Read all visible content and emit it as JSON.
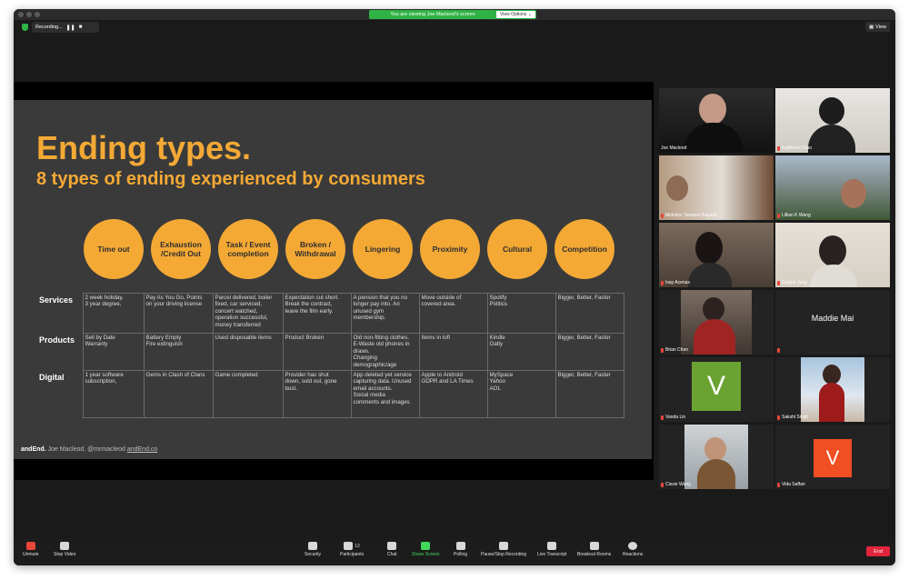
{
  "window": {
    "viewing_banner": "You are viewing Joe Macleod's screen",
    "view_options": "View Options ⌄",
    "recording": "Recording...",
    "view_button": "View"
  },
  "slide": {
    "title": "Ending types.",
    "subtitle": "8 types of ending experienced by consumers",
    "circles": [
      "Time out",
      "Exhaustion\n/Credit Out",
      "Task / Event\ncompletion",
      "Broken /\nWithdrawal",
      "Lingering",
      "Proximity",
      "Cultural",
      "Competition"
    ],
    "rows": [
      {
        "label": "Services",
        "cells": [
          "2 week holiday,\n3 year degree,",
          "Pay As You Go, Points\non your driving license",
          "Parcel delivered, boiler\nfixed, car serviced,\nconcert watched,\noperation successful,\nmoney transferred",
          "Expectation cut short.\nBreak the contract,\nleave the film early.",
          "A pension that you no\nlonger pay into. An\nunused gym\nmembership.",
          "Move outside of\ncovered area.",
          "Spotify\nPolitics",
          "Bigger, Better, Faster"
        ]
      },
      {
        "label": "Products",
        "cells": [
          "Sell by Date\nWarranty",
          "Battery Empty\nFire extinguish",
          "Used disposable items",
          "Product Broken",
          "Old non-fitting clothes.\nE-Waste old phones in\ndraws.\nChanging\ndemographic/age",
          "Items in loft",
          "Kindle\nOatly",
          "Bigger, Better, Faster"
        ]
      },
      {
        "label": "Digital",
        "cells": [
          "1 year software\nsubscription,",
          "Gems in Clash of Clans",
          "Game completed",
          "Provider has shut\ndown, sold out, gone\nbust.",
          "App deleted yet service\ncapturing data. Unused\nemail accounts.\nSocial media\ncomments and images",
          "Apple to Android\nGDPR and LA Times",
          "MySpace\nYahoo\nAOL",
          "Bigger, Better, Faster"
        ]
      }
    ],
    "footer": {
      "brand": "andEnd.",
      "author": " Joe Macleod. @mrmacleod ",
      "site": "andEnd.co"
    }
  },
  "participants": [
    {
      "name": "Joe Macleod",
      "active": true
    },
    {
      "name": "Kathleen Chao"
    },
    {
      "name": "Melchior Tamisier-Fayard"
    },
    {
      "name": "Lillian K Wang"
    },
    {
      "name": "Isay Acenas"
    },
    {
      "name": "Eunjoo Jung"
    },
    {
      "name": "Brian Chen"
    },
    {
      "name": "Maddie Mai"
    },
    {
      "name": "Vanda Lin",
      "initial": "V",
      "color": "#6aa332"
    },
    {
      "name": "Sakshi Singh"
    },
    {
      "name": "Cissie Wang"
    },
    {
      "name": "Vida Saffari",
      "initial": "V",
      "color": "#f04e23"
    }
  ],
  "toolbar": {
    "unmute": "Unmute",
    "stop_video": "Stop Video",
    "security": "Security",
    "participants": "Participants",
    "participants_count": "12",
    "chat": "Chat",
    "share_screen": "Share Screen",
    "polling": "Polling",
    "recording": "Pause/Stop Recording",
    "transcript": "Live Transcript",
    "breakout": "Breakout Rooms",
    "reactions": "Reactions",
    "end": "End"
  }
}
